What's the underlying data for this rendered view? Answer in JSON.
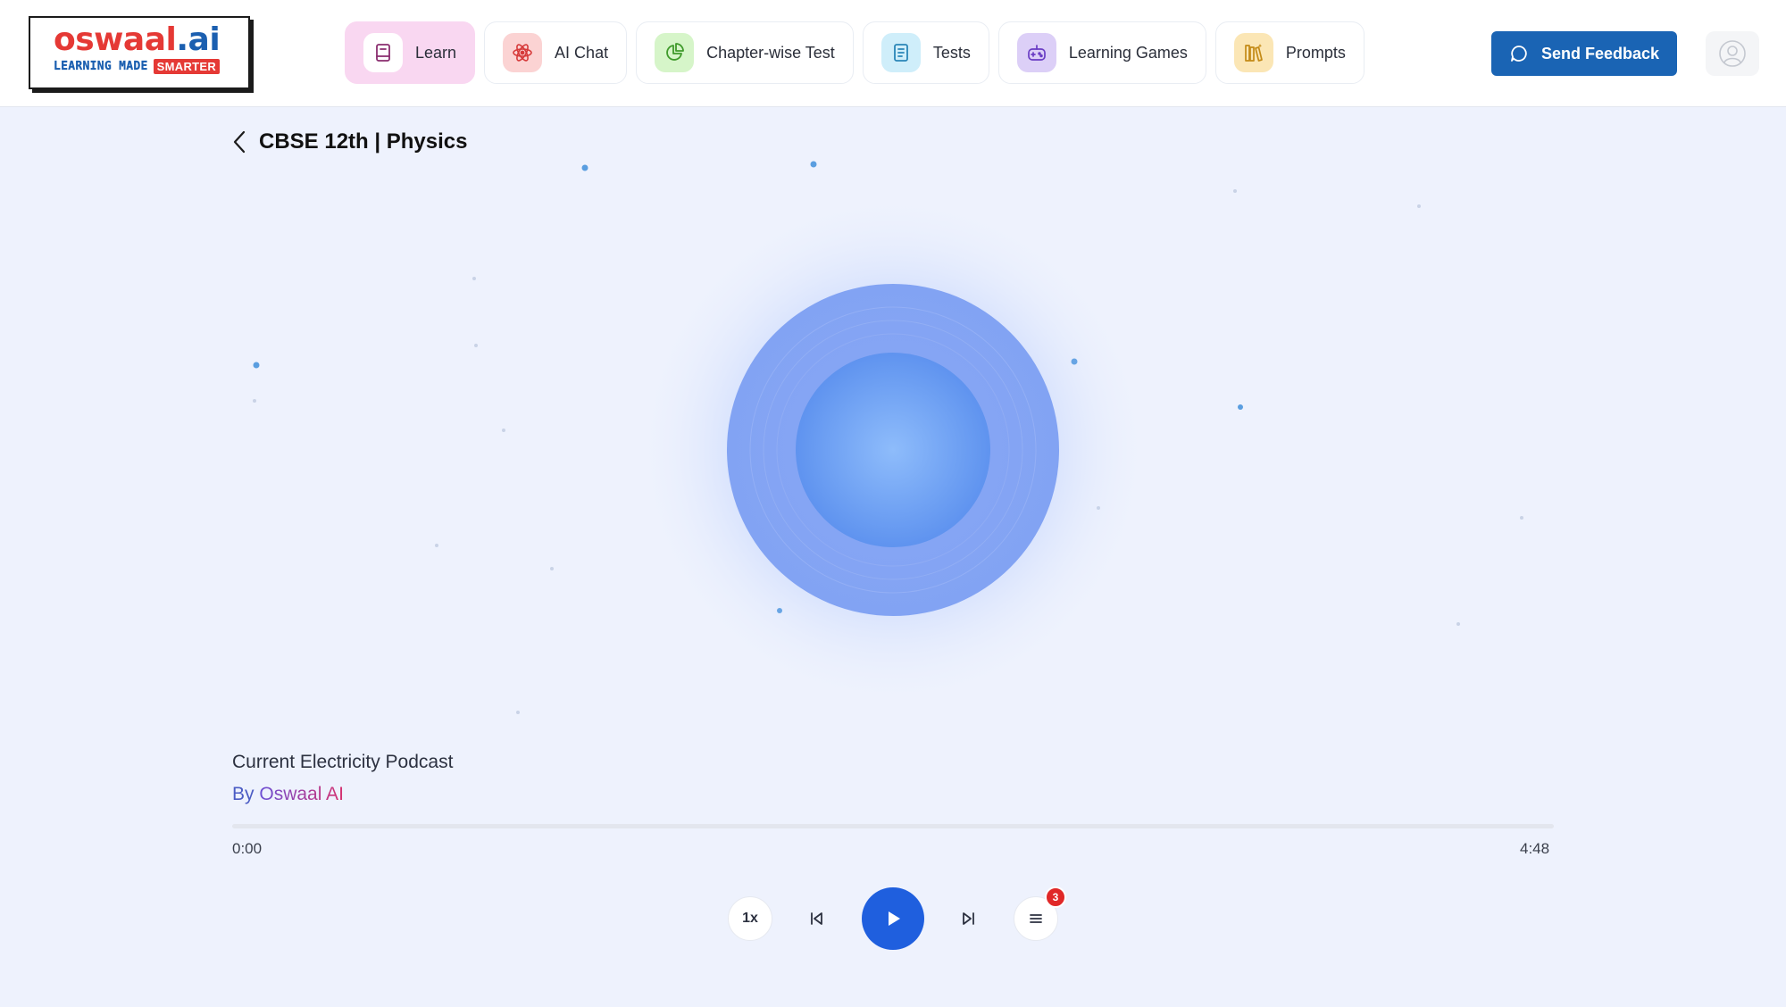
{
  "brand": {
    "logo_main_1": "oswaal",
    "logo_main_2": ".ai",
    "logo_tag_1": "LEARNING MADE",
    "logo_tag_2": "SMARTER"
  },
  "nav": {
    "items": [
      {
        "label": "Learn",
        "icon": "book-icon",
        "active": true
      },
      {
        "label": "AI Chat",
        "icon": "atom-icon",
        "active": false
      },
      {
        "label": "Chapter-wise Test",
        "icon": "pie-chart-icon",
        "active": false
      },
      {
        "label": "Tests",
        "icon": "document-icon",
        "active": false
      },
      {
        "label": "Learning Games",
        "icon": "gamepad-icon",
        "active": false
      },
      {
        "label": "Prompts",
        "icon": "books-icon",
        "active": false
      }
    ]
  },
  "header": {
    "feedback_label": "Send Feedback",
    "avatar_icon": "user-avatar-icon"
  },
  "page": {
    "title": "CBSE 12th | Physics"
  },
  "player": {
    "track_title": "Current Electricity Podcast",
    "author_prefix": "By",
    "author_name": "Oswaal AI",
    "current_time": "0:00",
    "total_time": "4:48",
    "progress": 0,
    "speed_label": "1x",
    "queue_count": "3"
  },
  "colors": {
    "accent": "#1a64b4",
    "play": "#1f5fde",
    "background": "#eef2fd",
    "learn_active": "#f9d7f1",
    "badge": "#e02828"
  }
}
